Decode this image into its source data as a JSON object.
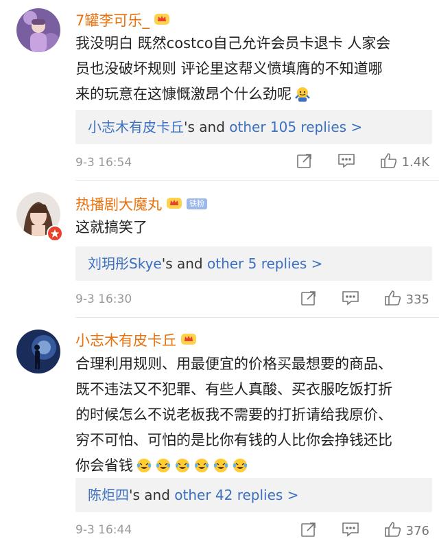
{
  "comments": [
    {
      "username": "7罐李可乐_",
      "content_lines": [
        "我没明白 既然costco自己允许会员卡退卡 人家会",
        "员也没破坏规则 评论里这帮义愤填膺的不知道哪",
        "来的玩意在这慷慨激昂个什么劲呢"
      ],
      "reply_user": "小志木有皮卡丘",
      "reply_mid": "'s and",
      "reply_count": "other 105 replies >",
      "time": "9-3 16:54",
      "likes": "1.4K",
      "has_fan_badge": false
    },
    {
      "username": "热播剧大魔丸",
      "fan_badge": "铁粉",
      "content_lines": [
        "这就搞笑了"
      ],
      "reply_user": "刘玥彤Skye",
      "reply_mid": "'s and",
      "reply_count": "other 5 replies >",
      "time": "9-3 16:30",
      "likes": "335",
      "has_fan_badge": true
    },
    {
      "username": "小志木有皮卡丘",
      "content_lines": [
        "合理利用规则、用最便宜的价格买最想要的商品、",
        "既不违法又不犯罪、有些人真酸、买衣服吃饭打折",
        "的时候怎么不说老板我不需要的打折请给我原价、",
        "穷不可怕、可怕的是比你有钱的人比你会挣钱还比",
        "你会省钱"
      ],
      "reply_user": "陈炬四",
      "reply_mid": "'s and",
      "reply_count": "other 42 replies >",
      "time": "9-3 16:44",
      "likes": "376",
      "has_fan_badge": false
    }
  ],
  "colors": {
    "username": "#e8720e",
    "link": "#3b6fc0",
    "meta": "#999999",
    "reply_bg": "#f2f2f2"
  },
  "icons": [
    "crown-badge-icon",
    "share-icon",
    "comment-icon",
    "like-icon",
    "shrug-emoji-icon",
    "laugh-cry-emoji-icon",
    "verified-badge-icon"
  ]
}
